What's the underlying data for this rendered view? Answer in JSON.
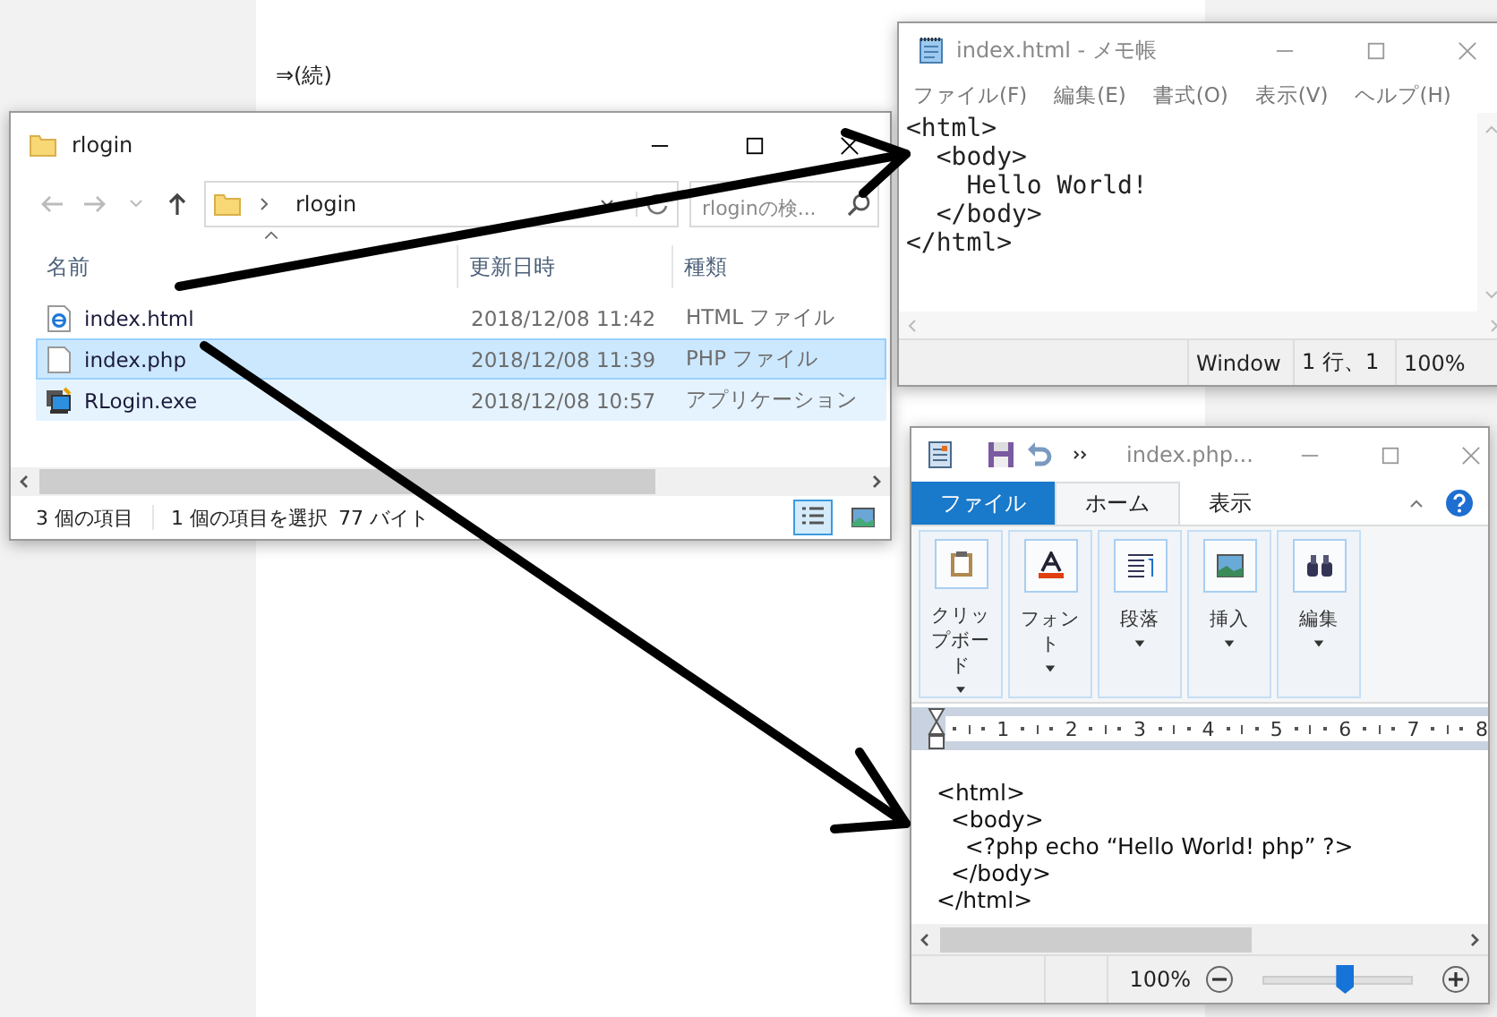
{
  "page": {
    "heading": "⇒(続)"
  },
  "explorer": {
    "title": "rlogin",
    "path": "rlogin",
    "search": {
      "placeholder": "rloginの検..."
    },
    "columns": [
      "名前",
      "更新日時",
      "種類"
    ],
    "rows": [
      {
        "name": "index.html",
        "date": "2018/12/08 11:42",
        "type": "HTML ファイル",
        "kind": "html",
        "selected": false,
        "hot": false
      },
      {
        "name": "index.php",
        "date": "2018/12/08 11:39",
        "type": "PHP ファイル",
        "kind": "file",
        "selected": true,
        "hot": false
      },
      {
        "name": "RLogin.exe",
        "date": "2018/12/08 10:57",
        "type": "アプリケーション",
        "kind": "app",
        "selected": false,
        "hot": true
      }
    ],
    "status": {
      "count": "3 個の項目",
      "selection": "1 個の項目を選択",
      "size": "77 バイト"
    },
    "views": [
      {
        "kind": "details",
        "selected": true
      },
      {
        "kind": "thumbnails",
        "selected": false
      }
    ]
  },
  "notepad": {
    "title": "index.html - メモ帳",
    "menu": [
      "ファイル(F)",
      "編集(E)",
      "書式(O)",
      "表示(V)",
      "ヘルプ(H)"
    ],
    "lines": [
      "<html>",
      "  <body>",
      "    Hello World!",
      "  </body>",
      "</html>"
    ],
    "status": [
      "Window",
      "1 行、1",
      "100%"
    ]
  },
  "wordpad": {
    "title": "index.php...",
    "tabs": [
      {
        "label": "ファイル",
        "kind": "file",
        "selected": false
      },
      {
        "label": "ホーム",
        "kind": "tab",
        "selected": true
      },
      {
        "label": "表示",
        "kind": "tab",
        "selected": false
      }
    ],
    "groups": [
      {
        "label": "クリップボード",
        "kind": "clipboard"
      },
      {
        "label": "フォント",
        "kind": "font"
      },
      {
        "label": "段落",
        "kind": "paragraph"
      },
      {
        "label": "挿入",
        "kind": "image"
      },
      {
        "label": "編集",
        "kind": "binoculars"
      }
    ],
    "ruler": [
      "1",
      "2",
      "3",
      "4",
      "5",
      "6",
      "7",
      "8"
    ],
    "lines": [
      "<html>",
      "  <body>",
      "    <?php echo “Hello World! php” ?>",
      "  </body>",
      "</html>"
    ],
    "zoom": {
      "reading": "100%",
      "level": 0.55
    }
  }
}
